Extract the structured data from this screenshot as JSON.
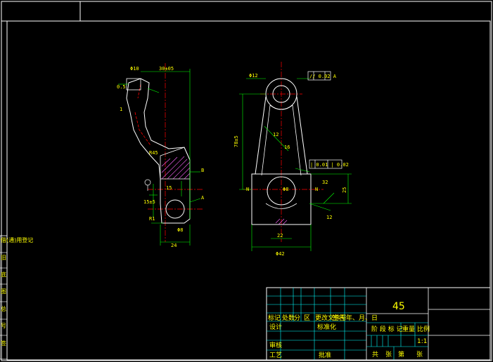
{
  "colors": {
    "background": "#000000",
    "frame": "#ffffff",
    "dimension": "#00ff00",
    "centerline": "#ff0000",
    "text": "#ffff00",
    "hatch": "#ff66ff",
    "table_lines": "#00ffff"
  },
  "side_view": {
    "dims": {
      "top_width": "Φ10",
      "overall_h": "30±05",
      "side_chamfer": "0.5",
      "len_1": "1",
      "r45": "R45",
      "label_b": "B",
      "label_a": "A",
      "h15": "15",
      "h1545": "15±5",
      "phi_bore": "Φ8",
      "bottom_w": "24",
      "r1": "R1"
    }
  },
  "front_view": {
    "dims": {
      "top_hole": "Φ12",
      "tol_top": "// 0.02 A",
      "height_main": "78±5",
      "height_right": "25",
      "tol_mid": "| 0.01 | 0.02",
      "bore_center": "Φ8",
      "n_left": "N",
      "n_right": "N",
      "ang_32": "32",
      "ang_12": "12",
      "width_42": "Φ42",
      "w_22": "22",
      "r_16": "16",
      "w_12": "12"
    }
  },
  "title_block": {
    "material": "45",
    "row_headers": [
      "标记",
      "处数",
      "分",
      "区",
      "更改文件号",
      "签名",
      "年、月、日"
    ],
    "designer": "设计",
    "standardize": "标准化",
    "review": "审核",
    "process": "工艺",
    "approve": "批准",
    "stage_mark": "阶 段 标 记",
    "weight": "重量",
    "scale": "比例",
    "scale_val": "1:1",
    "total": "共",
    "sheet": "张",
    "page": "第",
    "page_sheet": "张"
  },
  "left_strip": {
    "label_top": "借(通)用登记",
    "label_1": "旧",
    "label_2": "底",
    "label_3": "图",
    "label_4": "总",
    "label_5": "号",
    "label_6": "签",
    "label_7": "字"
  }
}
